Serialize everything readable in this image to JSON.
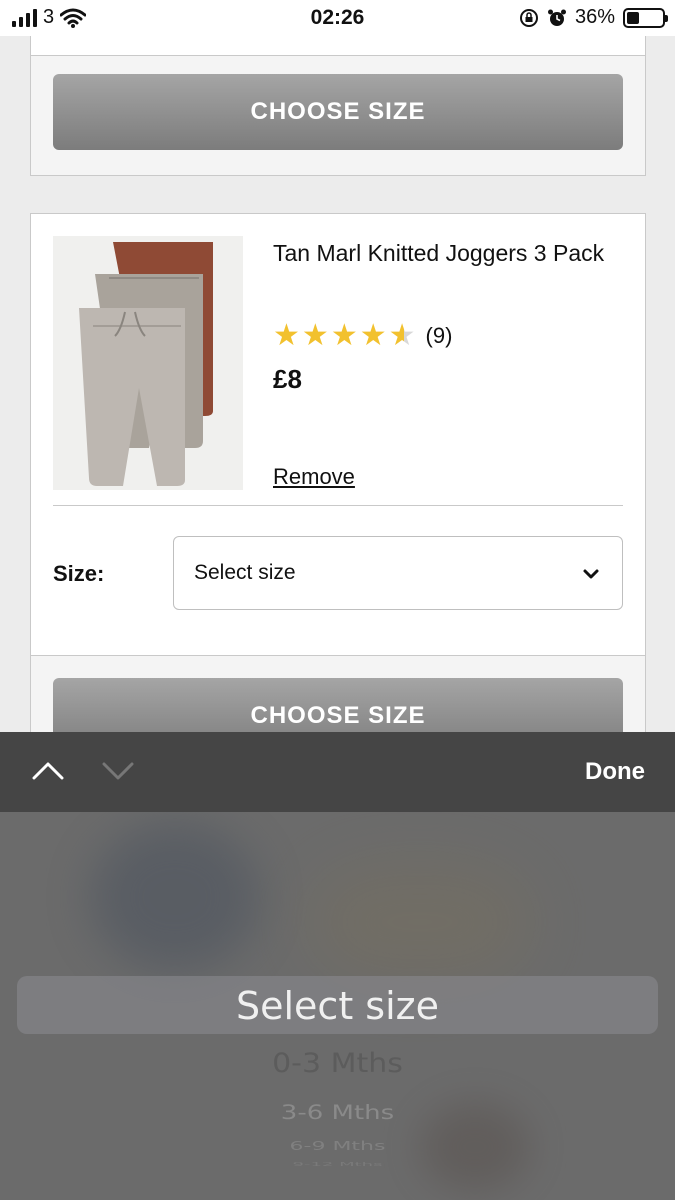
{
  "status_bar": {
    "carrier": "3",
    "time": "02:26",
    "battery_percent": "36%",
    "battery_level": 0.36,
    "icons": [
      "signal-bars-icon",
      "wifi-icon",
      "rotation-lock-icon",
      "alarm-icon",
      "battery-icon"
    ]
  },
  "previous_item": {
    "choose_size_label": "CHOOSE SIZE"
  },
  "basket_item": {
    "title": "Tan Marl Knitted Joggers 3 Pack",
    "rating": 4.5,
    "rating_max": 5,
    "review_count": "(9)",
    "price": "£8",
    "remove_label": "Remove",
    "size_label": "Size:",
    "size_value": "Select size",
    "choose_size_label": "CHOOSE SIZE",
    "image_colors": [
      "#8f4a35",
      "#a9a39b",
      "#bdb7b1"
    ]
  },
  "picker_toolbar": {
    "done_label": "Done",
    "icons": [
      "chevron-up-icon",
      "chevron-down-icon"
    ]
  },
  "picker": {
    "selected": "Select size",
    "options": [
      "0-3 Mths",
      "3-6 Mths",
      "6-9 Mths",
      "9-12 Mths"
    ]
  }
}
